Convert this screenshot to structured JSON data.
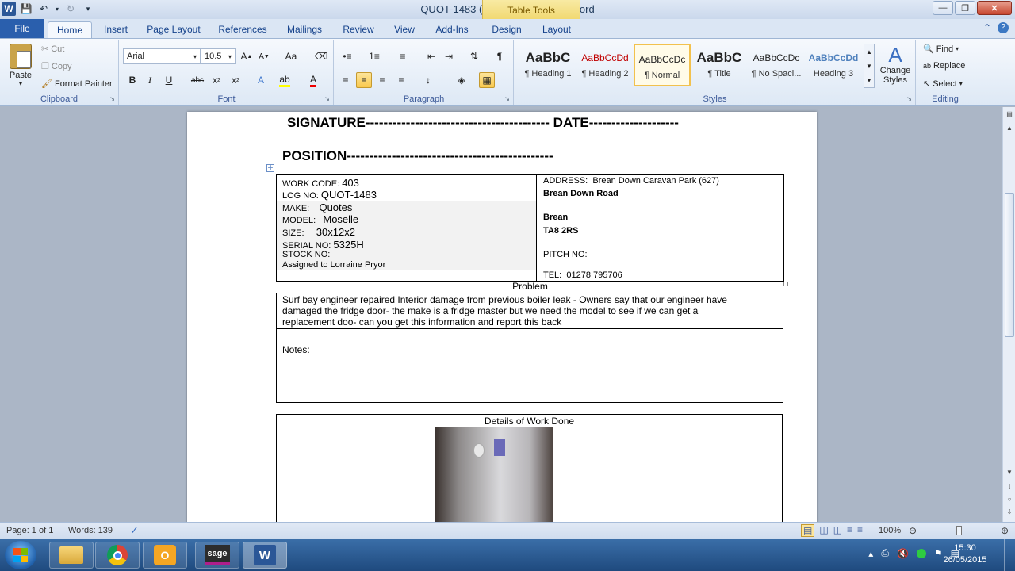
{
  "window": {
    "title": "QUOT-1483 (1).docx - Microsoft Word",
    "context_tab": "Table Tools"
  },
  "ribbon_tabs": [
    "File",
    "Home",
    "Insert",
    "Page Layout",
    "References",
    "Mailings",
    "Review",
    "View",
    "Add-Ins",
    "Design",
    "Layout"
  ],
  "clipboard": {
    "paste": "Paste",
    "cut": "Cut",
    "copy": "Copy",
    "format_painter": "Format Painter",
    "label": "Clipboard"
  },
  "font": {
    "name": "Arial",
    "size": "10.5",
    "label": "Font"
  },
  "paragraph": {
    "label": "Paragraph"
  },
  "styles": {
    "label": "Styles",
    "items": [
      {
        "sample": "AaBbC",
        "name": "¶ Heading 1"
      },
      {
        "sample": "AaBbCcDd",
        "name": "¶ Heading 2"
      },
      {
        "sample": "AaBbCcDc",
        "name": "¶ Normal"
      },
      {
        "sample": "AaBbC",
        "name": "¶ Title"
      },
      {
        "sample": "AaBbCcDc",
        "name": "¶ No Spaci..."
      },
      {
        "sample": "AaBbCcDd",
        "name": "Heading 3"
      }
    ],
    "change_styles": "Change Styles"
  },
  "editing": {
    "label": "Editing",
    "find": "Find",
    "replace": "Replace",
    "select": "Select"
  },
  "document": {
    "signature_line": "SIGNATURE----------------------------------------- DATE--------------------",
    "position_line": "POSITION----------------------------------------------",
    "left_fields": [
      {
        "label": "WORK CODE:",
        "value": "403"
      },
      {
        "label": "LOG NO:",
        "value": "QUOT-1483"
      },
      {
        "label": "MAKE:",
        "value": "Quotes"
      },
      {
        "label": "MODEL:",
        "value": "Moselle"
      },
      {
        "label": "SIZE:",
        "value": "30x12x2"
      },
      {
        "label": "SERIAL  NO:",
        "value": "5325H"
      },
      {
        "label": "STOCK NO:",
        "value": ""
      },
      {
        "label": "Assigned to Lorraine Pryor",
        "value": ""
      }
    ],
    "address_label": "ADDRESS:",
    "address_value": "Brean Down Caravan Park (627)",
    "address_line2": "Brean Down Road",
    "address_line3": "Brean",
    "address_line4": "TA8 2RS",
    "pitch": "PITCH NO:",
    "tel_label": "TEL:",
    "tel_value": "01278  795706",
    "problem_header": "Problem",
    "problem_text_1": " Surf bay engineer repaired Interior damage from previous boiler leak - Owners say that our engineer have",
    "problem_text_2": "damaged the fridge door- the make is a fridge master but we need the model to see if we can get a",
    "problem_text_3": "replacement doo- can you get this information and report this back",
    "notes_label": "Notes:",
    "details_header": "Details of Work Done"
  },
  "status": {
    "page": "Page: 1 of 1",
    "words": "Words: 139",
    "zoom": "100%"
  },
  "taskbar": {
    "apps": [
      "explorer",
      "chrome",
      "outlook",
      "sage",
      "word"
    ],
    "time": "15:30",
    "date": "26/05/2015"
  }
}
